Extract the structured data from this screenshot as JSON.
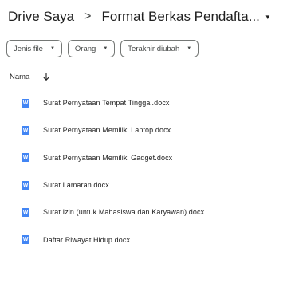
{
  "breadcrumb": {
    "root": "Drive Saya",
    "separator": ">",
    "current": "Format Berkas Pendafta...",
    "caret_icon": "caret-down-icon"
  },
  "filters": [
    {
      "label": "Jenis file"
    },
    {
      "label": "Orang"
    },
    {
      "label": "Terakhir diubah"
    }
  ],
  "list_header": {
    "name_label": "Nama",
    "sort_icon": "arrow-down-icon"
  },
  "files": [
    {
      "name": "Surat Pernyataan Tempat Tinggal.docx",
      "icon": "word-doc-icon"
    },
    {
      "name": "Surat Pernyataan Memiliki Laptop.docx",
      "icon": "word-doc-icon"
    },
    {
      "name": "Surat Pernyataan Memiliki Gadget.docx",
      "icon": "word-doc-icon"
    },
    {
      "name": "Surat Lamaran.docx",
      "icon": "word-doc-icon"
    },
    {
      "name": "Surat Izin (untuk Mahasiswa dan Karyawan).docx",
      "icon": "word-doc-icon"
    },
    {
      "name": "Daftar Riwayat Hidup.docx",
      "icon": "word-doc-icon"
    }
  ],
  "colors": {
    "doc_icon": "#4285f4",
    "chip_border": "#747775",
    "text": "#1f1f1f"
  }
}
